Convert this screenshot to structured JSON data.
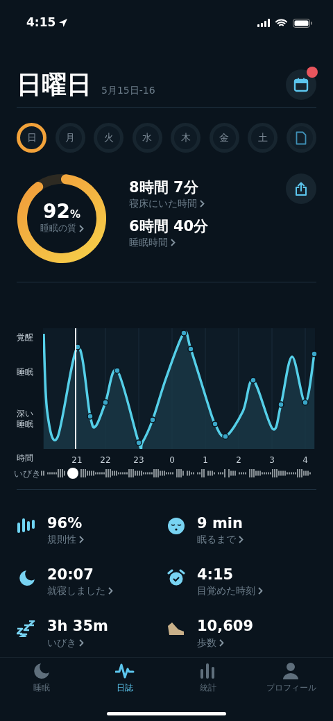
{
  "status_bar": {
    "time": "4:15"
  },
  "header": {
    "title": "日曜日",
    "date_range": "5月15日-16",
    "calendar_badge": true
  },
  "days": [
    {
      "label": "日",
      "selected": true
    },
    {
      "label": "月",
      "selected": false
    },
    {
      "label": "火",
      "selected": false
    },
    {
      "label": "水",
      "selected": false
    },
    {
      "label": "木",
      "selected": false
    },
    {
      "label": "金",
      "selected": false
    },
    {
      "label": "土",
      "selected": false
    }
  ],
  "summary": {
    "quality": {
      "value": "92",
      "unit": "%",
      "label": "睡眠の質",
      "level": 0.92
    },
    "metrics": [
      {
        "value": "8時間 7分",
        "label": "寝床にいた時間"
      },
      {
        "value": "6時間 40分",
        "label": "睡眠時間"
      }
    ]
  },
  "chart": {
    "y_labels": [
      "覚醒",
      "睡眠",
      "深い睡眠"
    ],
    "x_title": "時間",
    "x_labels": [
      "21",
      "22",
      "23",
      "0",
      "1",
      "2",
      "3",
      "4"
    ],
    "snore_label": "いびき",
    "playhead": {
      "level": 0.12
    }
  },
  "stats": [
    {
      "kind": "regularity",
      "value": "96%",
      "label": "規則性"
    },
    {
      "kind": "fall_asleep",
      "value": "9 min",
      "label": "眠るまで"
    },
    {
      "kind": "bedtime",
      "value": "20:07",
      "label": "就寝しました"
    },
    {
      "kind": "wake",
      "value": "4:15",
      "label": "目覚めた時刻"
    },
    {
      "kind": "snore",
      "value": "3h 35m",
      "label": "いびき"
    },
    {
      "kind": "steps",
      "value": "10,609",
      "label": "歩数"
    }
  ],
  "tabs": [
    {
      "kind": "sleep",
      "label": "睡眠",
      "selected": false
    },
    {
      "kind": "journal",
      "label": "日誌",
      "selected": true
    },
    {
      "kind": "stats",
      "label": "統計",
      "selected": false
    },
    {
      "kind": "profile",
      "label": "プロフィール",
      "selected": false
    }
  ]
}
